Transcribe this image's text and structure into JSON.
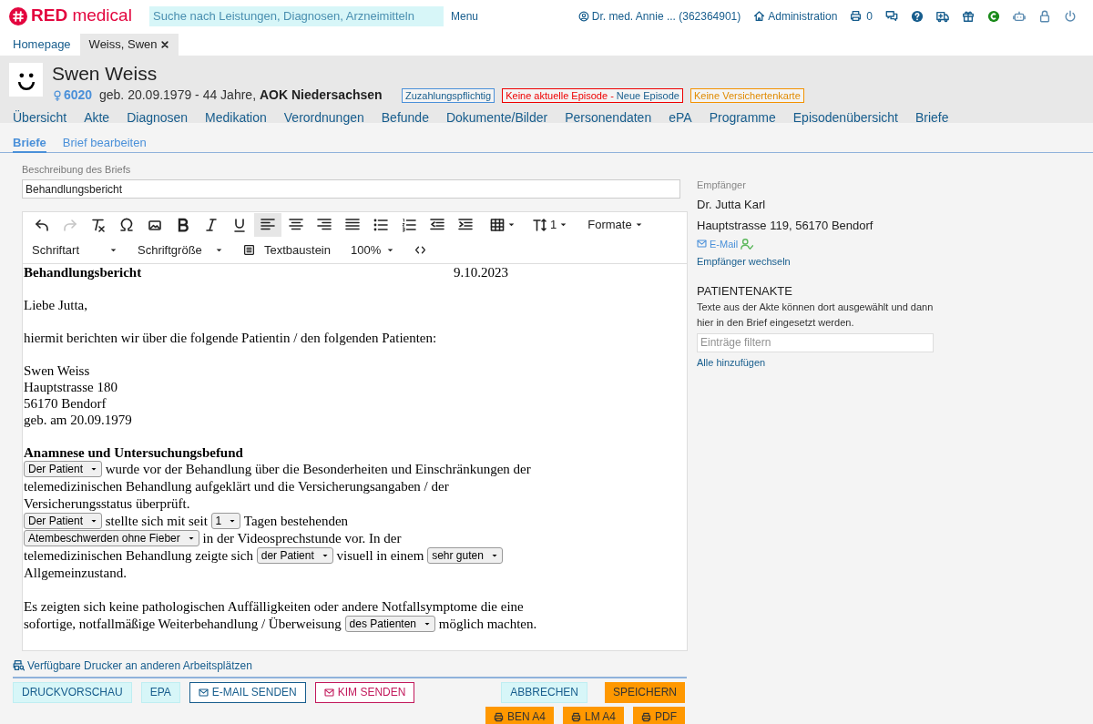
{
  "logo": {
    "brand": "RED",
    "product": "medical"
  },
  "search": {
    "placeholder": "Suche nach Leistungen, Diagnosen, Arzneimitteln"
  },
  "menu": "Menu",
  "user": "Dr. med. Annie ... (362364901)",
  "admin": "Administration",
  "print_count": "0",
  "tabs": [
    {
      "label": "Homepage",
      "selected": false,
      "closable": false
    },
    {
      "label": "Weiss, Swen",
      "selected": true,
      "closable": true
    }
  ],
  "patient": {
    "name": "Swen Weiss",
    "id": "6020",
    "birth": "geb. 20.09.1979 - 44 Jahre,",
    "insurance": "AOK Niedersachsen",
    "badges": [
      {
        "kind": "info",
        "text": "Zuzahlungspflichtig"
      },
      {
        "kind": "alert",
        "text": "Keine aktuelle Episode -",
        "link": "Neue Episode"
      },
      {
        "kind": "warning",
        "text": "Keine Versichertenkarte"
      }
    ]
  },
  "nav": [
    "Übersicht",
    "Akte",
    "Diagnosen",
    "Medikation",
    "Verordnungen",
    "Befunde",
    "Dokumente/Bilder",
    "Personendaten",
    "ePA",
    "Programme",
    "Episodenübersicht",
    "Briefe"
  ],
  "subtabs": [
    {
      "label": "Briefe",
      "selected": true
    },
    {
      "label": "Brief bearbeiten",
      "selected": false
    }
  ],
  "description": {
    "label": "Beschreibung des Briefs",
    "value": "Behandlungsbericht"
  },
  "toolbar_row_1": [
    {
      "kind": "icon",
      "selected": false,
      "disabled": false
    },
    {
      "kind": "icon",
      "selected": false,
      "disabled": true
    },
    {
      "kind": "icon",
      "selected": false,
      "disabled": false
    },
    {
      "kind": "icon",
      "selected": false,
      "disabled": false
    },
    {
      "kind": "icon",
      "selected": false,
      "disabled": false
    },
    {
      "kind": "icon",
      "selected": false,
      "disabled": false
    },
    {
      "kind": "icon",
      "selected": false,
      "disabled": false
    },
    {
      "kind": "icon",
      "selected": false,
      "disabled": false
    },
    {
      "kind": "icon",
      "selected": true,
      "disabled": false
    },
    {
      "kind": "icon",
      "selected": false,
      "disabled": false
    },
    {
      "kind": "icon",
      "selected": false,
      "disabled": false
    },
    {
      "kind": "icon",
      "selected": false,
      "disabled": false
    },
    {
      "kind": "icon",
      "selected": false,
      "disabled": false
    },
    {
      "kind": "icon",
      "selected": false,
      "disabled": false
    },
    {
      "kind": "icon",
      "selected": false,
      "disabled": false
    },
    {
      "kind": "icon",
      "selected": false,
      "disabled": false
    },
    {
      "kind": "dropdown",
      "selected": false,
      "disabled": false
    },
    {
      "kind": "dropdown",
      "label": "1",
      "selected": false,
      "disabled": false
    },
    {
      "kind": "dropdown",
      "label": "Formate",
      "selected": false,
      "disabled": false
    }
  ],
  "toolbar_row_2": [
    {
      "kind": "dropdown",
      "label": "Schriftart"
    },
    {
      "kind": "dropdown",
      "label": "Schriftgröße"
    },
    {
      "kind": "button",
      "label": "Textbaustein"
    },
    {
      "kind": "dropdown",
      "label": "100%"
    },
    {
      "kind": "icon"
    }
  ],
  "letter": {
    "title": "Behandlungsbericht",
    "date": "9.10.2023",
    "blocks": [
      {
        "kind": "lines",
        "lines": [
          "Liebe Jutta,"
        ]
      },
      {
        "kind": "lines",
        "lines": [
          "hiermit berichten wir über die folgende Patientin / den folgenden Patienten:"
        ]
      },
      {
        "kind": "lines",
        "lines": [
          "Swen Weiss",
          "Hauptstrasse 180",
          "56170 Bendorf",
          "geb. am 20.09.1979"
        ]
      },
      {
        "kind": "section",
        "heading": "Anamnese und Untersuchungsbefund",
        "segments": [
          {
            "kind": "select",
            "value": "Der Patient"
          },
          {
            "kind": "text",
            "text": " wurde vor der Behandlung über die Besonderheiten und Einschränkungen der"
          },
          {
            "kind": "break"
          },
          {
            "kind": "text",
            "text": "telemedizinischen Behandlung aufgeklärt und die Versicherungsangaben / der"
          },
          {
            "kind": "break"
          },
          {
            "kind": "text",
            "text": "Versicherungsstatus überprüft."
          },
          {
            "kind": "break"
          },
          {
            "kind": "select",
            "value": "Der Patient"
          },
          {
            "kind": "text",
            "text": " stellte sich mit seit "
          },
          {
            "kind": "select",
            "value": "1"
          },
          {
            "kind": "text",
            "text": " Tagen bestehenden"
          },
          {
            "kind": "break"
          },
          {
            "kind": "select",
            "value": "Atembeschwerden ohne Fieber"
          },
          {
            "kind": "text",
            "text": " in der Videosprechstunde vor. In der"
          },
          {
            "kind": "break"
          },
          {
            "kind": "text",
            "text": "telemedizinischen Behandlung zeigte sich "
          },
          {
            "kind": "select",
            "value": "der Patient"
          },
          {
            "kind": "text",
            "text": " visuell in einem "
          },
          {
            "kind": "select",
            "value": "sehr guten"
          },
          {
            "kind": "break"
          },
          {
            "kind": "text",
            "text": "Allgemeinzustand."
          }
        ]
      },
      {
        "kind": "section",
        "segments": [
          {
            "kind": "text",
            "text": "Es zeigten sich keine pathologischen Auffälligkeiten oder andere Notfallsymptome die eine"
          },
          {
            "kind": "break"
          },
          {
            "kind": "text",
            "text": "sofortige, notfallmäßige Weiterbehandlung / Überweisung "
          },
          {
            "kind": "select",
            "value": "des Patienten"
          },
          {
            "kind": "text",
            "text": " möglich machten."
          }
        ]
      }
    ]
  },
  "recipient": {
    "label": "Empfänger",
    "name": "Dr. Jutta Karl",
    "address": "Hauptstrasse 119, 56170 Bendorf",
    "email": "E-Mail",
    "change": "Empfänger wechseln"
  },
  "patient_record": {
    "heading": "PATIENTENAKTE",
    "text": "Texte aus der Akte können dort ausgewählt und dann hier in den Brief eingesetzt werden.",
    "filter_placeholder": "Einträge filtern",
    "add_all": "Alle hinzufügen"
  },
  "printers_link": "Verfügbare Drucker an anderen Arbeitsplätzen",
  "buttons_left": [
    {
      "kind": "light",
      "label": "DRUCKVORSCHAU"
    },
    {
      "kind": "light",
      "label": "EPA"
    },
    {
      "kind": "outline-blue",
      "label": "E-MAIL SENDEN"
    },
    {
      "kind": "outline-pink",
      "label": "KIM SENDEN"
    }
  ],
  "buttons_right": [
    {
      "kind": "light",
      "label": "ABBRECHEN"
    },
    {
      "kind": "orange",
      "label": "SPEICHERN"
    }
  ],
  "print_buttons": [
    {
      "kind": "orange",
      "label": "BEN A4"
    },
    {
      "kind": "orange",
      "label": "LM A4"
    },
    {
      "kind": "orange",
      "label": "PDF"
    }
  ]
}
